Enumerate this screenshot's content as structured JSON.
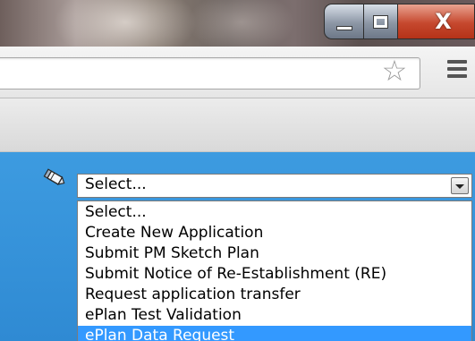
{
  "window": {
    "controls": {
      "minimize_icon": "minimize-icon",
      "maximize_icon": "maximize-icon",
      "close_glyph": "X",
      "close_color": "#c6482e"
    }
  },
  "toolbar": {
    "star_glyph": "☆",
    "star_icon": "bookmark-star-icon",
    "menu_icon": "hamburger-menu-icon"
  },
  "page": {
    "background": "#3399dd",
    "select_icon": "pencil-edit-icon",
    "select": {
      "value": "Select...",
      "options": [
        "Select...",
        "Create New Application",
        "Submit PM Sketch Plan",
        "Submit Notice of Re-Establishment (RE)",
        "Request application transfer",
        "ePlan Test Validation",
        "ePlan Data Request"
      ],
      "highlighted_index": 6,
      "highlight_color": "#3399ff"
    }
  }
}
